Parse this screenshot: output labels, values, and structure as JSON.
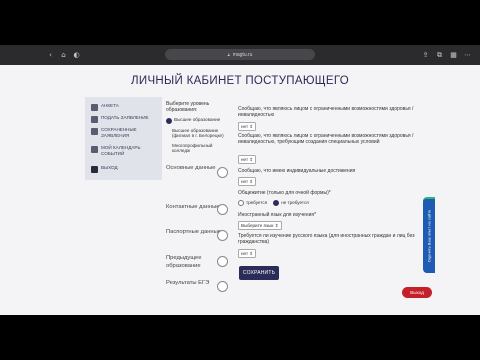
{
  "browser": {
    "url": "magtu.ru",
    "icons": [
      "back-icon",
      "home-icon",
      "shield-icon",
      "lock-icon",
      "share-icon",
      "tabs-icon",
      "grid-icon",
      "more-icon"
    ]
  },
  "page": {
    "title": "ЛИЧНЫЙ КАБИНЕТ ПОСТУПАЮЩЕГО"
  },
  "sidebar": {
    "items": [
      {
        "label": "АНКЕТА",
        "icon": "document-icon"
      },
      {
        "label": "ПОДАТЬ ЗАЯВЛЕНИЕ",
        "icon": "application-icon"
      },
      {
        "label": "СОХРАНЕННЫЕ ЗАЯВЛЕНИЯ",
        "icon": "saved-icon"
      },
      {
        "label": "МОЙ КАЛЕНДАРЬ СОБЫТИЙ",
        "icon": "calendar-icon"
      },
      {
        "label": "ВЫХОД",
        "icon": "logout-icon"
      }
    ]
  },
  "education": {
    "heading": "Выберите уровень образования:",
    "options": [
      {
        "label": "Высшее образование",
        "selected": true
      },
      {
        "label": "Высшее образование (филиал в г. Белорецке)",
        "selected": false
      },
      {
        "label": "Многопрофильный колледж",
        "selected": false
      }
    ]
  },
  "steps": [
    {
      "label": "Основные данные"
    },
    {
      "label": "Контактные данные"
    },
    {
      "label": "Паспортные данные"
    },
    {
      "label": "Предыдущее образование"
    },
    {
      "label": "Результаты ЕГЭ"
    }
  ],
  "form": {
    "questions": [
      {
        "text": "Сообщаю, что являюсь лицом с ограниченными возможностями здоровья / инвалидностью",
        "value": "нет"
      },
      {
        "text": "Сообщаю, что являюсь лицом с ограниченными возможностями здоровья / инвалидностью, требующим создания специальных условий",
        "value": "нет"
      },
      {
        "text": "Сообщаю, что имею индивидуальные достижения",
        "value": "нет"
      },
      {
        "text": "Общежитие (только для очной формы)*"
      },
      {
        "text": "Иностранный язык для изучения*",
        "value": "Выберите язык"
      },
      {
        "text": "Требуется ли изучение русского языка (для иностранных граждан и лиц без гражданства)",
        "value": "нет"
      }
    ],
    "dormitory_options": [
      {
        "label": "требуется",
        "selected": false
      },
      {
        "label": "не требуется",
        "selected": true
      }
    ],
    "save_label": "СОХРАНИТЬ"
  },
  "feedback_label": "Оценить Ваш опыт на сайте",
  "exit_label": "Выход",
  "colors": {
    "accent": "#2c2c5a",
    "exit": "#c51f2a",
    "feedback": "#1e5bb2"
  }
}
